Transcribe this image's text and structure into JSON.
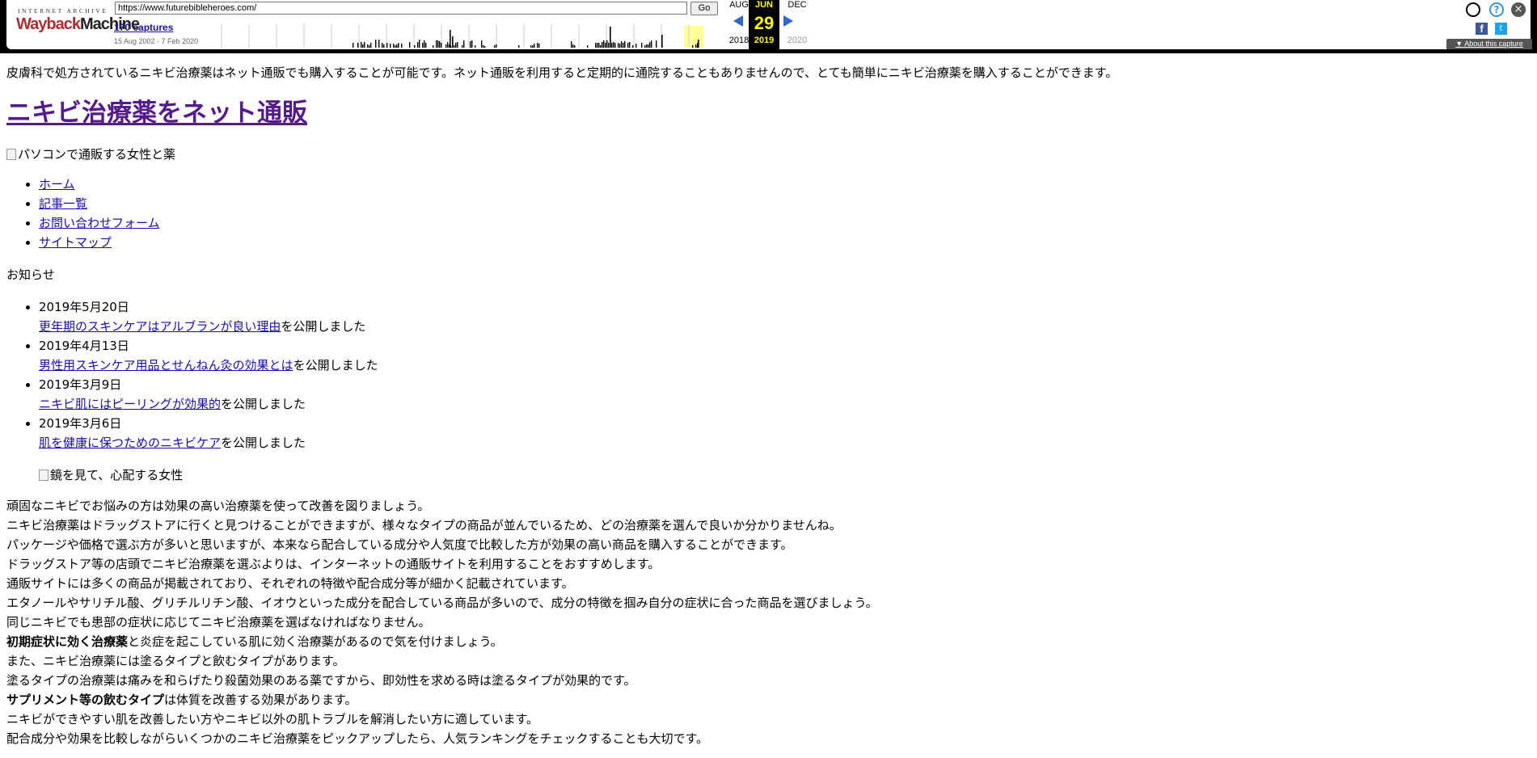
{
  "wayback": {
    "logo_top": "INTERNET ARCHIVE",
    "logo_way": "Wayback",
    "logo_machine": "Machine",
    "url": "https://www.futurebibleheroes.com/",
    "go_label": "Go",
    "captures": "170 captures",
    "date_range": "15 Aug 2002 - 7 Feb 2020",
    "prev_month": "AUG",
    "cur_month": "JUN",
    "next_month": "DEC",
    "cur_day": "29",
    "prev_year": "2018",
    "cur_year": "2019",
    "next_year": "2020",
    "about": "About this capture",
    "colors": {
      "highlight": "#ffff99",
      "arrow": "#3366cc",
      "logo_red": "#ab2e33"
    }
  },
  "page": {
    "intro": "皮膚科で処方されているニキビ治療薬はネット通販でも購入することが可能です。ネット通販を利用すると定期的に通院することもありませんので、とても簡単にニキビ治療薬を購入することができます。",
    "title": "ニキビ治療薬をネット通販",
    "hero_alt": "パソコンで通販する女性と薬",
    "nav": [
      {
        "label": "ホーム"
      },
      {
        "label": "記事一覧"
      },
      {
        "label": "お問い合わせフォーム"
      },
      {
        "label": "サイトマップ"
      }
    ],
    "notice_title": "お知らせ",
    "news": [
      {
        "date": "2019年5月20日",
        "link": "更年期のスキンケアはアルブランが良い理由",
        "suffix": "を公開しました"
      },
      {
        "date": "2019年4月13日",
        "link": "男性用スキンケア用品とせんねん灸の効果とは",
        "suffix": "を公開しました"
      },
      {
        "date": "2019年3月9日",
        "link": "ニキビ肌にはピーリングが効果的",
        "suffix": "を公開しました"
      },
      {
        "date": "2019年3月6日",
        "link": "肌を健康に保つためのニキビケア",
        "suffix": "を公開しました"
      }
    ],
    "img2_alt": "鏡を見て、心配する女性",
    "body": [
      {
        "bold": "",
        "text": "頑固なニキビでお悩みの方は効果の高い治療薬を使って改善を図りましょう。"
      },
      {
        "bold": "",
        "text": "ニキビ治療薬はドラッグストアに行くと見つけることができますが、様々なタイプの商品が並んでいるため、どの治療薬を選んで良いか分かりませんね。"
      },
      {
        "bold": "",
        "text": "パッケージや価格で選ぶ方が多いと思いますが、本来なら配合している成分や人気度で比較した方が効果の高い商品を購入することができます。"
      },
      {
        "bold": "",
        "text": "ドラッグストア等の店頭でニキビ治療薬を選ぶよりは、インターネットの通販サイトを利用することをおすすめします。"
      },
      {
        "bold": "",
        "text": "通販サイトには多くの商品が掲載されており、それぞれの特徴や配合成分等が細かく記載されています。"
      },
      {
        "bold": "",
        "text": "エタノールやサリチル酸、グリチルリチン酸、イオウといった成分を配合している商品が多いので、成分の特徴を掴み自分の症状に合った商品を選びましょう。"
      },
      {
        "bold": "",
        "text": "同じニキビでも患部の症状に応じてニキビ治療薬を選ばなければなりません。"
      },
      {
        "bold": "初期症状に効く治療薬",
        "text": "と炎症を起こしている肌に効く治療薬があるので気を付けましょう。"
      },
      {
        "bold": "",
        "text": "また、ニキビ治療薬には塗るタイプと飲むタイプがあります。"
      },
      {
        "bold": "",
        "text": "塗るタイプの治療薬は痛みを和らげたり殺菌効果のある薬ですから、即効性を求める時は塗るタイプが効果的です。"
      },
      {
        "bold": "サプリメント等の飲むタイプ",
        "text": "は体質を改善する効果があります。"
      },
      {
        "bold": "",
        "text": "ニキビができやすい肌を改善したい方やニキビ以外の肌トラブルを解消したい方に適しています。"
      },
      {
        "bold": "",
        "text": "配合成分や効果を比較しながらいくつかのニキビ治療薬をピックアップしたら、人気ランキングをチェックすることも大切です。"
      }
    ]
  }
}
